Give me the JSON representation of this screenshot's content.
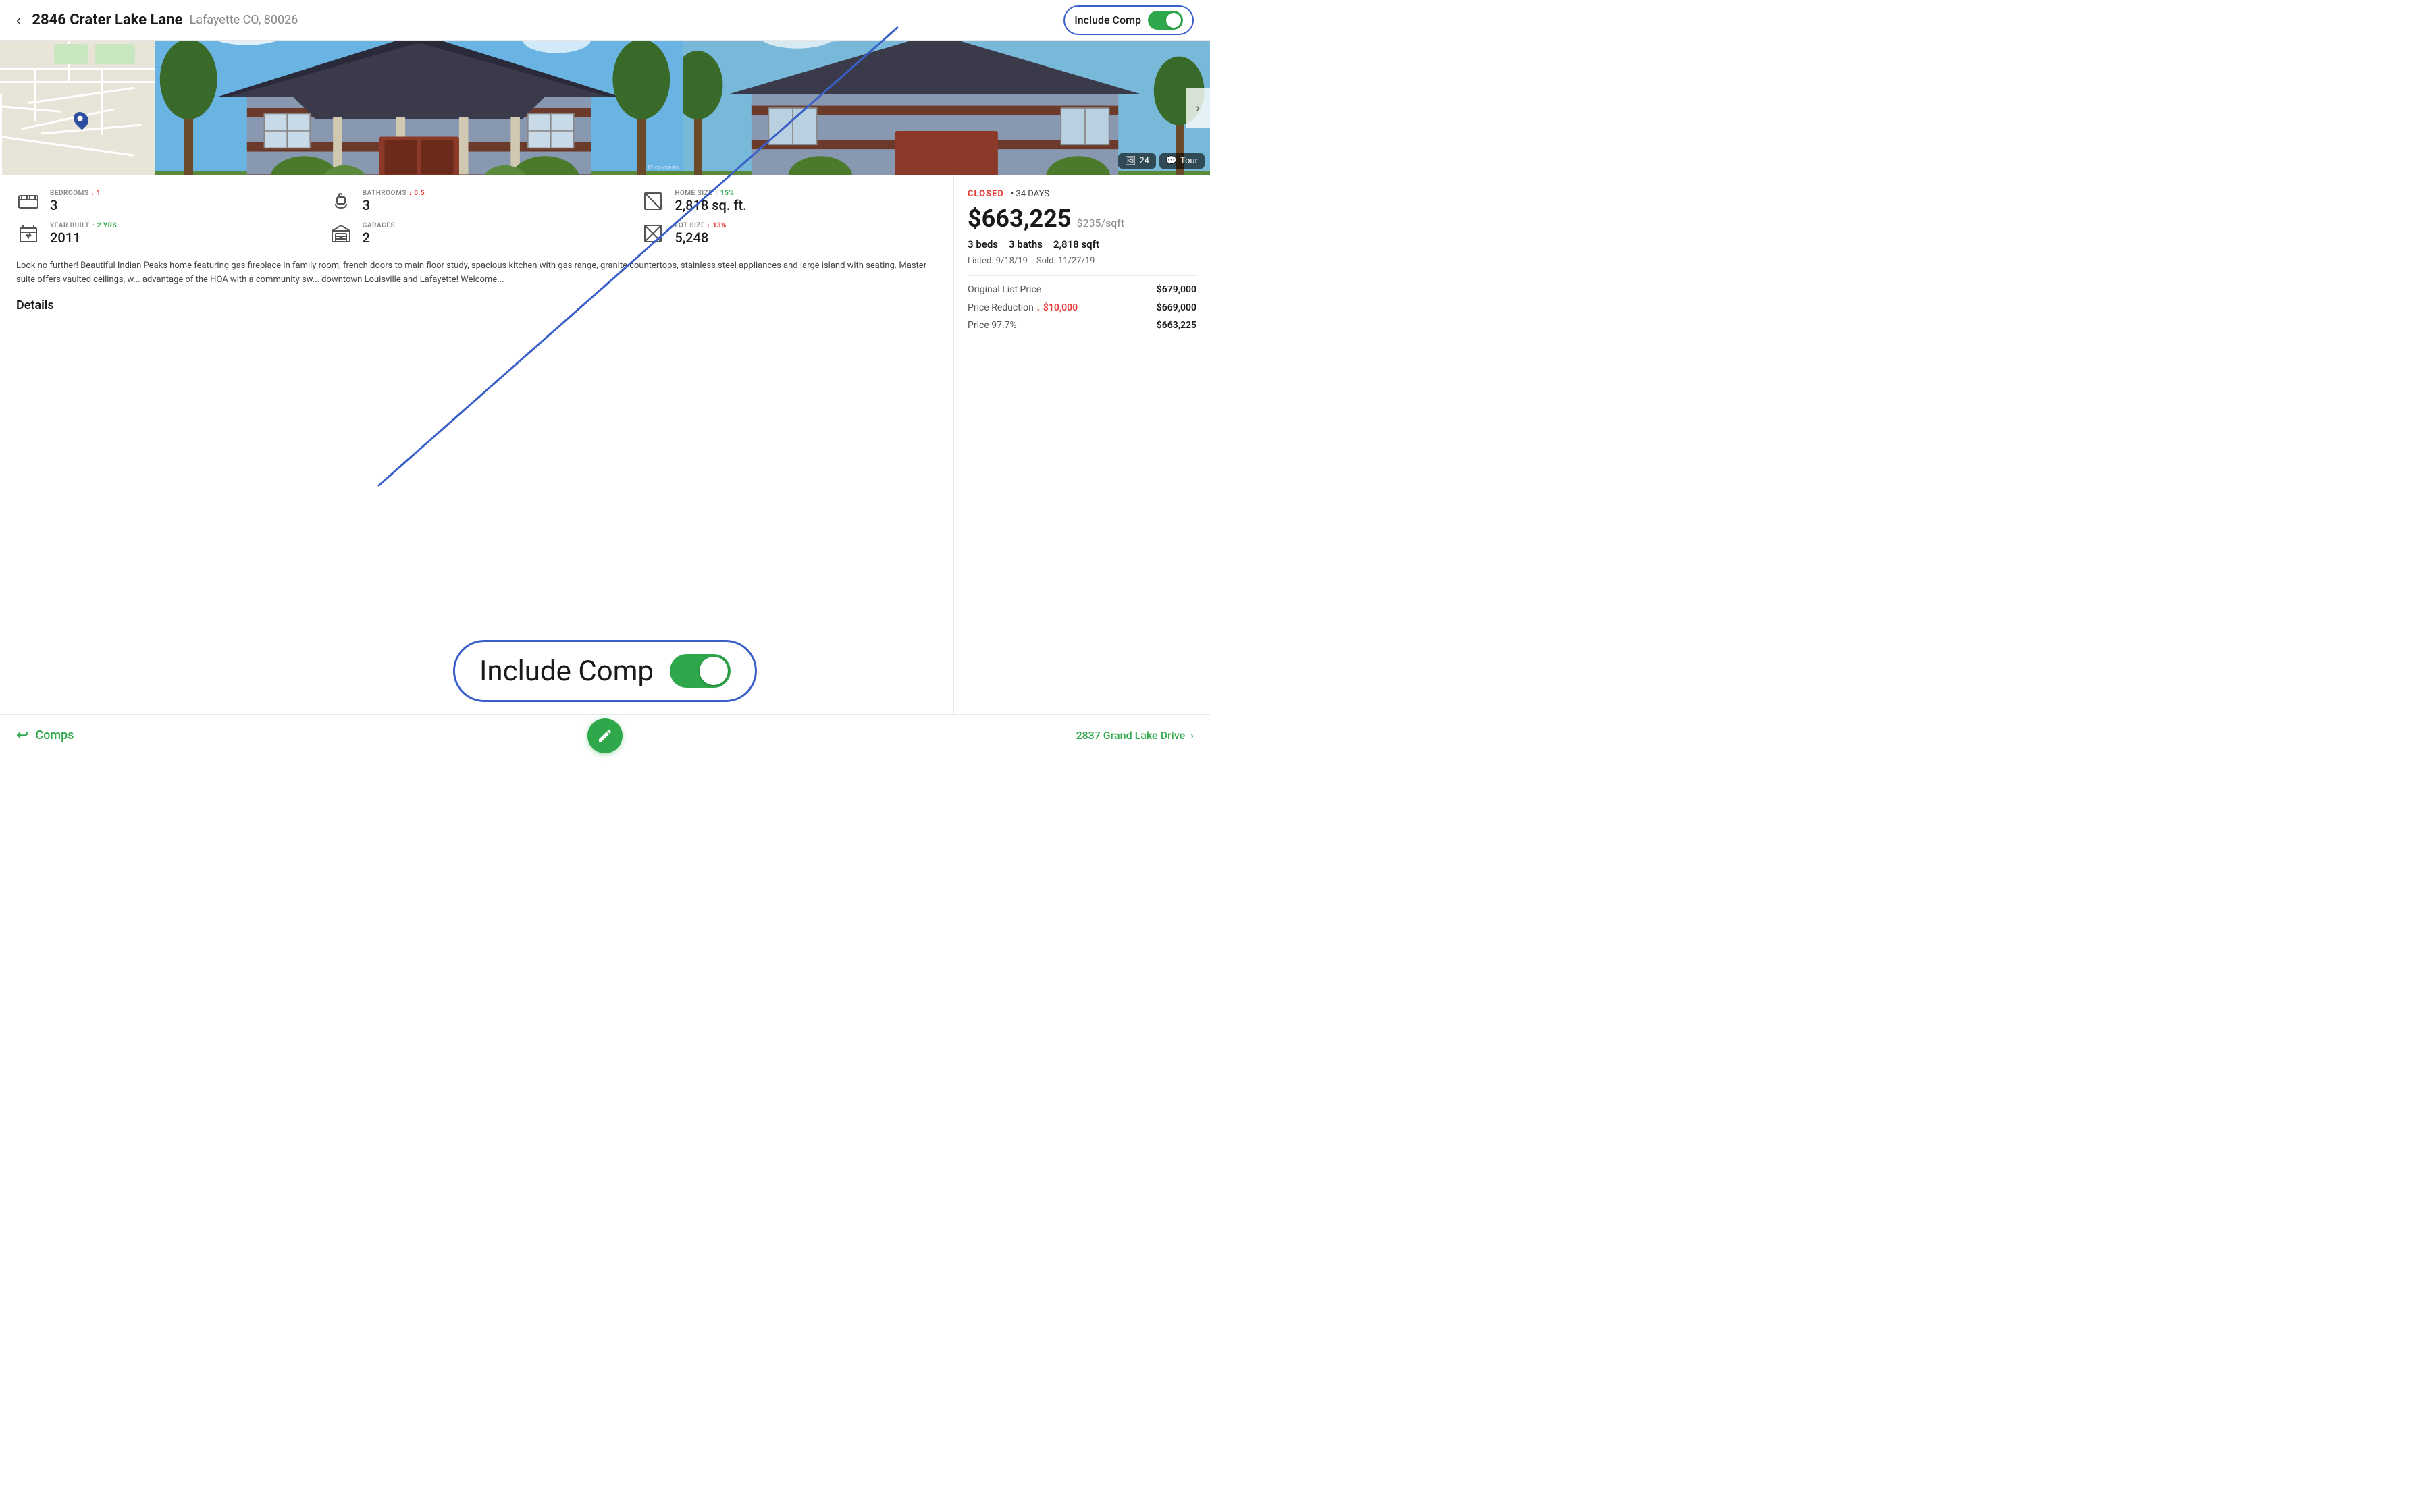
{
  "header": {
    "back_label": "‹",
    "title": "2846 Crater Lake Lane",
    "subtitle": "Lafayette CO, 80026",
    "include_comp_label": "Include Comp"
  },
  "images": {
    "photo_count": "24",
    "tour_label": "Tour"
  },
  "stats": [
    {
      "label": "BEDROOMS",
      "diff": "↓ 1",
      "diff_type": "down",
      "value": "3",
      "icon": "bed"
    },
    {
      "label": "BATHROOMS",
      "diff": "↓ 0.5",
      "diff_type": "down",
      "value": "3",
      "icon": "bath"
    },
    {
      "label": "HOME SIZE",
      "diff": "↑ 15%",
      "diff_type": "up",
      "value": "2,818 sq. ft.",
      "icon": "home-size"
    },
    {
      "label": "YEAR BUILT",
      "diff": "↑ 2 yrs",
      "diff_type": "up",
      "value": "2011",
      "icon": "year-built"
    },
    {
      "label": "GARAGES",
      "diff": "",
      "diff_type": "",
      "value": "2",
      "icon": "garage"
    },
    {
      "label": "LOT SIZE",
      "diff": "↓ 13%",
      "diff_type": "down",
      "value": "5,248",
      "icon": "lot-size"
    }
  ],
  "description": "Look no further! Beautiful Indian Peaks home featuring gas fireplace in family room, french doors to main floor study, spacious kitchen with gas range, granite countertops, stainless steel appliances and large island with seating. Master suite offers vaulted ceilings, w... advantage of the HOA with a community sw... downtown Louisville and Lafayette! Welcome...",
  "details_heading": "Details",
  "right_panel": {
    "status": "CLOSED",
    "days": "• 34 DAYS",
    "price": "$663,225",
    "price_sqft": "$235/sqft",
    "beds": "3",
    "baths": "3",
    "sqft": "2,818",
    "beds_label": "beds",
    "baths_label": "baths",
    "sqft_label": "sqft",
    "listed": "Listed: 9/18/19",
    "sold": "Sold: 11/27/19",
    "original_list_price_label": "Original List Price",
    "original_list_price": "$679,000",
    "reduction_label": "Price Reduction",
    "reduction_badge": "↓ $10,000",
    "reduction_value": "$669,000",
    "final_price_label": "Price 97.7%",
    "final_price": "$663,225"
  },
  "bottom_bar": {
    "comps_label": "Comps",
    "next_address": "2837 Grand Lake Drive"
  },
  "overlay": {
    "label": "Include Comp"
  }
}
